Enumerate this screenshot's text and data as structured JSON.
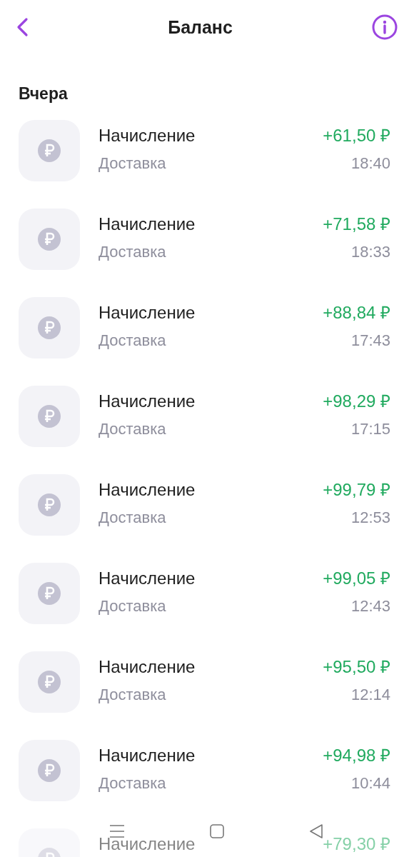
{
  "header": {
    "title": "Баланс"
  },
  "section": {
    "title": "Вчера"
  },
  "transactions": [
    {
      "title": "Начисление",
      "subtitle": "Доставка",
      "amount": "+61,50 ₽",
      "time": "18:40"
    },
    {
      "title": "Начисление",
      "subtitle": "Доставка",
      "amount": "+71,58 ₽",
      "time": "18:33"
    },
    {
      "title": "Начисление",
      "subtitle": "Доставка",
      "amount": "+88,84 ₽",
      "time": "17:43"
    },
    {
      "title": "Начисление",
      "subtitle": "Доставка",
      "amount": "+98,29 ₽",
      "time": "17:15"
    },
    {
      "title": "Начисление",
      "subtitle": "Доставка",
      "amount": "+99,79 ₽",
      "time": "12:53"
    },
    {
      "title": "Начисление",
      "subtitle": "Доставка",
      "amount": "+99,05 ₽",
      "time": "12:43"
    },
    {
      "title": "Начисление",
      "subtitle": "Доставка",
      "amount": "+95,50 ₽",
      "time": "12:14"
    },
    {
      "title": "Начисление",
      "subtitle": "Доставка",
      "amount": "+94,98 ₽",
      "time": "10:44"
    },
    {
      "title": "Начисление",
      "amount": "+79,30 ₽"
    }
  ]
}
